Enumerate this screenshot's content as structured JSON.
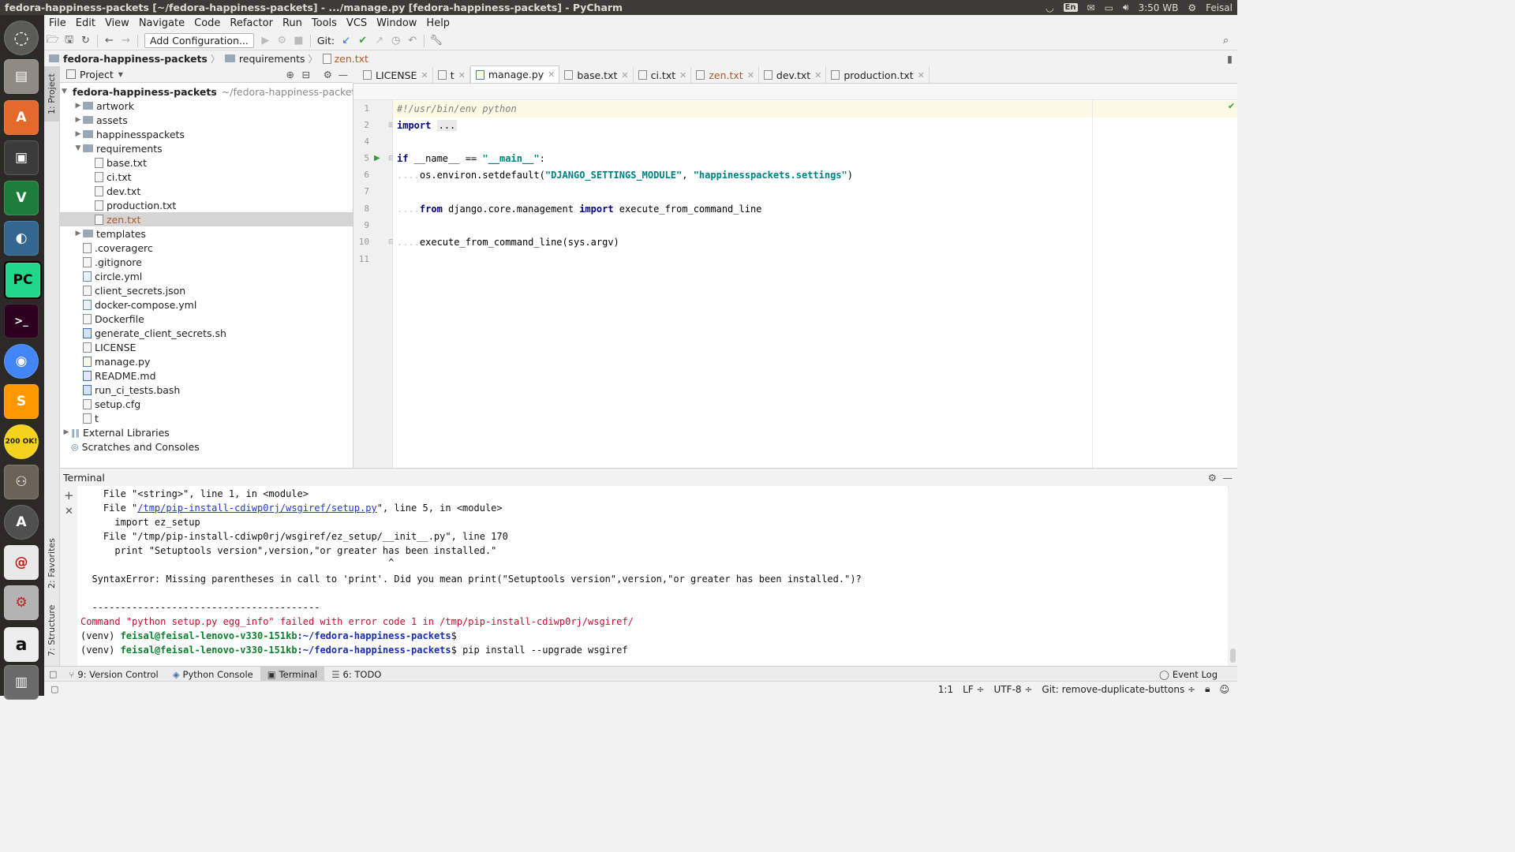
{
  "window": {
    "title": "fedora-happiness-packets [~/fedora-happiness-packets] - .../manage.py [fedora-happiness-packets] - PyCharm"
  },
  "tray": {
    "keyboard": "En",
    "time": "3:50 WB",
    "user": "Feisal"
  },
  "launcher": {
    "items": [
      "dash-icon",
      "files-icon",
      "software-center-icon",
      "video-editor-icon",
      "vim-icon",
      "postgres-icon",
      "pycharm-icon",
      "terminal-icon",
      "chrome-icon",
      "sublime-text-icon",
      "okular-icon",
      "gimp-icon",
      "software-updater-icon",
      "evolution-icon",
      "system-settings-icon",
      "amazon-icon",
      "trash-icon"
    ],
    "labels": {
      "pycharm": "PC",
      "vim": "V",
      "sublime": "S",
      "amazon": "a",
      "okular": "200 OK!"
    }
  },
  "menubar": [
    "File",
    "Edit",
    "View",
    "Navigate",
    "Code",
    "Refactor",
    "Run",
    "Tools",
    "VCS",
    "Window",
    "Help"
  ],
  "toolbar": {
    "add_configuration": "Add Configuration...",
    "git_label": "Git:"
  },
  "breadcrumb": [
    "fedora-happiness-packets",
    "requirements",
    "zen.txt"
  ],
  "left_strip": {
    "project": "1: Project",
    "favorites": "2: Favorites",
    "structure": "7: Structure"
  },
  "project": {
    "header": "Project",
    "root_name": "fedora-happiness-packets",
    "root_path": "~/fedora-happiness-packets",
    "items": [
      {
        "name": "artwork",
        "type": "folder",
        "level": 1,
        "expanded": false
      },
      {
        "name": "assets",
        "type": "folder",
        "level": 1,
        "expanded": false
      },
      {
        "name": "happinesspackets",
        "type": "folder",
        "level": 1,
        "expanded": false
      },
      {
        "name": "requirements",
        "type": "folder",
        "level": 1,
        "expanded": true
      },
      {
        "name": "base.txt",
        "type": "file",
        "level": 2
      },
      {
        "name": "ci.txt",
        "type": "file",
        "level": 2
      },
      {
        "name": "dev.txt",
        "type": "file",
        "level": 2
      },
      {
        "name": "production.txt",
        "type": "file",
        "level": 2
      },
      {
        "name": "zen.txt",
        "type": "file",
        "level": 2,
        "selected": true
      },
      {
        "name": "templates",
        "type": "folder",
        "level": 1,
        "expanded": false
      },
      {
        "name": ".coveragerc",
        "type": "file",
        "level": 1
      },
      {
        "name": ".gitignore",
        "type": "file",
        "level": 1
      },
      {
        "name": "circle.yml",
        "type": "yml",
        "level": 1
      },
      {
        "name": "client_secrets.json",
        "type": "file",
        "level": 1
      },
      {
        "name": "docker-compose.yml",
        "type": "yml",
        "level": 1
      },
      {
        "name": "Dockerfile",
        "type": "file",
        "level": 1
      },
      {
        "name": "generate_client_secrets.sh",
        "type": "sh",
        "level": 1
      },
      {
        "name": "LICENSE",
        "type": "file",
        "level": 1
      },
      {
        "name": "manage.py",
        "type": "py",
        "level": 1
      },
      {
        "name": "README.md",
        "type": "md",
        "level": 1
      },
      {
        "name": "run_ci_tests.bash",
        "type": "sh",
        "level": 1
      },
      {
        "name": "setup.cfg",
        "type": "file",
        "level": 1
      },
      {
        "name": "t",
        "type": "file",
        "level": 1
      }
    ],
    "external_libraries": "External Libraries",
    "scratches": "Scratches and Consoles"
  },
  "editor": {
    "tabs": [
      {
        "label": "LICENSE"
      },
      {
        "label": "t"
      },
      {
        "label": "manage.py",
        "active": true,
        "kind": "py"
      },
      {
        "label": "base.txt"
      },
      {
        "label": "ci.txt"
      },
      {
        "label": "zen.txt",
        "highlight": true
      },
      {
        "label": "dev.txt"
      },
      {
        "label": "production.txt"
      }
    ],
    "line_numbers": [
      "1",
      "2",
      "4",
      "5",
      "6",
      "7",
      "8",
      "9",
      "10",
      "11"
    ],
    "code": {
      "shebang": "#!/usr/bin/env python",
      "import_kw": "import",
      "import_fold": "...",
      "if_kw": "if",
      "name_cmp": " __name__ == ",
      "main_str": "\"__main__\"",
      "colon": ":",
      "environ_call": "os.environ.setdefault(",
      "settings_key": "\"DJANGO_SETTINGS_MODULE\"",
      "comma": ", ",
      "settings_val": "\"happinesspackets.settings\"",
      "close_paren": ")",
      "from_kw": "from",
      "module": " django.core.management ",
      "import_kw2": "import",
      "exec_name": " execute_from_command_line",
      "exec_call": "execute_from_command_line(sys.argv)"
    }
  },
  "terminal": {
    "title": "Terminal",
    "lines": {
      "l1": "    File \"<string>\", line 1, in <module>",
      "l2_pre": "    File \"",
      "l2_link": "/tmp/pip-install-cdiwp0rj/wsgiref/setup.py",
      "l2_post": "\", line 5, in <module>",
      "l3": "      import ez_setup",
      "l4": "    File \"/tmp/pip-install-cdiwp0rj/wsgiref/ez_setup/__init__.py\", line 170",
      "l5": "      print \"Setuptools version\",version,\"or greater has been installed.\"",
      "l6": "                                                      ^",
      "l7": "  SyntaxError: Missing parentheses in call to 'print'. Did you mean print(\"Setuptools version\",version,\"or greater has been installed.\")?",
      "l8": "  ----------------------------------------",
      "l9": "Command \"python setup.py egg_info\" failed with error code 1 in /tmp/pip-install-cdiwp0rj/wsgiref/",
      "prompt_venv": "(venv) ",
      "prompt_user": "feisal@feisal-lenovo-v330-151kb",
      "prompt_path": ":~/fedora-happiness-packets",
      "prompt_end": "$",
      "command": " pip install --upgrade wsgiref"
    }
  },
  "bottom_tools": [
    {
      "label": "9: Version Control"
    },
    {
      "label": "Python Console"
    },
    {
      "label": "Terminal",
      "active": true
    },
    {
      "label": "6: TODO"
    }
  ],
  "event_log": "Event Log",
  "status": {
    "position": "1:1",
    "line_sep": "LF",
    "encoding": "UTF-8",
    "git_branch": "Git: remove-duplicate-buttons"
  },
  "colors": {
    "accent_selected": "#d5d5d5",
    "error_red": "#c0102e",
    "prompt_green": "#0e7f2e",
    "prompt_blue": "#1a2ea8",
    "keyword_navy": "#000080",
    "string_teal": "#008080"
  }
}
